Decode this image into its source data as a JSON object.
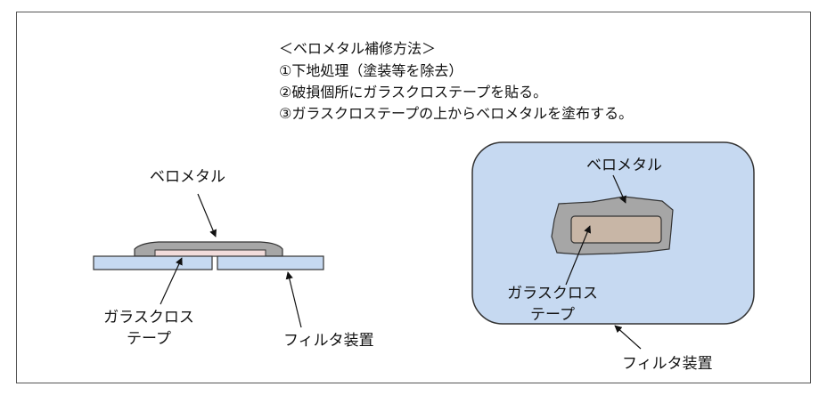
{
  "procedure": {
    "title": "＜ベロメタル補修方法＞",
    "steps": [
      "①下地処理（塗装等を除去）",
      "②破損個所にガラスクロステープを貼る。",
      "③ガラスクロステープの上からベロメタルを塗布する。"
    ]
  },
  "cross_section": {
    "label_metal": "ベロメタル",
    "label_tape_1": "ガラスクロス",
    "label_tape_2": "テープ",
    "label_filter": "フィルタ装置"
  },
  "plan_view": {
    "label_metal": "ベロメタル",
    "label_tape_1": "ガラスクロス",
    "label_tape_2": "テープ",
    "label_filter": "フィルタ装置"
  },
  "colors": {
    "filter_fill": "#c6d9f1",
    "metal_fill": "#a6a6a6",
    "tape_fill": "#c8b6a6",
    "tape_section_fill": "#f2dcdb",
    "outline": "#333333"
  }
}
